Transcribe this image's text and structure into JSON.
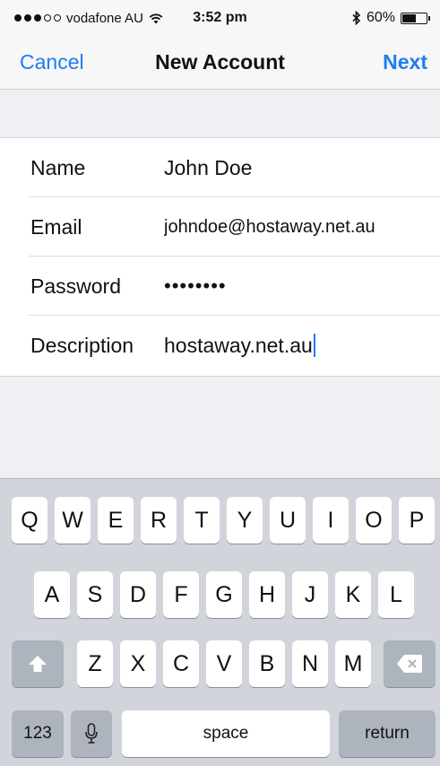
{
  "status_bar": {
    "carrier": "vodafone AU",
    "time": "3:52 pm",
    "battery_text": "60%",
    "battery_level": 0.6,
    "signal_bars_filled": 3,
    "signal_bars_total": 5
  },
  "nav": {
    "cancel_label": "Cancel",
    "title": "New Account",
    "next_label": "Next",
    "accent_color": "#1e7cf2"
  },
  "form": {
    "fields": [
      {
        "label": "Name",
        "value": "John Doe"
      },
      {
        "label": "Email",
        "value": "johndoe@hostaway.net.au"
      },
      {
        "label": "Password",
        "value": "••••••••"
      },
      {
        "label": "Description",
        "value": "hostaway.net.au"
      }
    ]
  },
  "keyboard": {
    "row1": [
      "Q",
      "W",
      "E",
      "R",
      "T",
      "Y",
      "U",
      "I",
      "O",
      "P"
    ],
    "row2": [
      "A",
      "S",
      "D",
      "F",
      "G",
      "H",
      "J",
      "K",
      "L"
    ],
    "row3": [
      "Z",
      "X",
      "C",
      "V",
      "B",
      "N",
      "M"
    ],
    "numbers_label": "123",
    "space_label": "space",
    "return_label": "return",
    "icons": {
      "shift": "shift-arrow-icon",
      "delete": "backspace-icon",
      "dictation": "microphone-icon"
    }
  }
}
